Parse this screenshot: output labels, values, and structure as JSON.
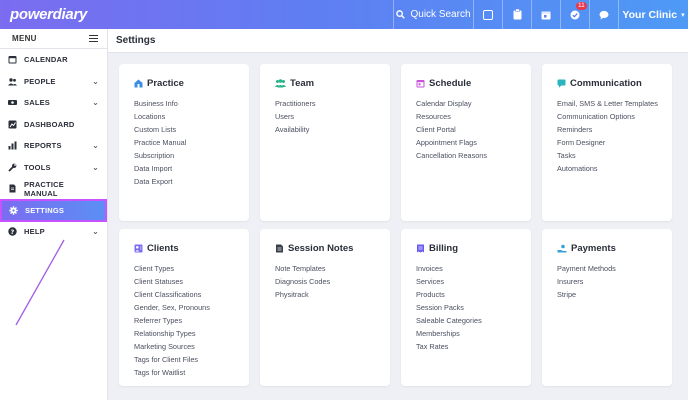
{
  "app": {
    "logo": "powerdiary"
  },
  "topbar": {
    "search_label": "Quick Search",
    "notification_count": "11",
    "clinic_label": "Your Clinic"
  },
  "sidebar": {
    "menu_label": "MENU",
    "items": [
      {
        "label": "CALENDAR",
        "icon": "calendar-icon",
        "chevron": ""
      },
      {
        "label": "PEOPLE",
        "icon": "people-icon",
        "chevron": "⌄"
      },
      {
        "label": "SALES",
        "icon": "sales-icon",
        "chevron": "⌄"
      },
      {
        "label": "DASHBOARD",
        "icon": "dashboard-icon",
        "chevron": ""
      },
      {
        "label": "REPORTS",
        "icon": "reports-icon",
        "chevron": "⌄"
      },
      {
        "label": "TOOLS",
        "icon": "wrench-icon",
        "chevron": "⌄"
      },
      {
        "label": "PRACTICE MANUAL",
        "icon": "document-icon",
        "chevron": ""
      },
      {
        "label": "SETTINGS",
        "icon": "gear-icon",
        "chevron": ""
      },
      {
        "label": "HELP",
        "icon": "help-icon",
        "chevron": "⌄"
      }
    ]
  },
  "page": {
    "title": "Settings"
  },
  "colors": {
    "practice": "#3a8ee6",
    "team": "#27b38a",
    "schedule": "#c653d8",
    "communication": "#2bb3c0",
    "clients": "#7b6cf0",
    "session_notes": "#3a3f4a",
    "billing": "#6a5cf0",
    "payments": "#36a0d8"
  },
  "cards": [
    {
      "title": "Practice",
      "links": [
        "Business Info",
        "Locations",
        "Custom Lists",
        "Practice Manual",
        "Subscription",
        "Data Import",
        "Data Export"
      ]
    },
    {
      "title": "Team",
      "links": [
        "Practitioners",
        "Users",
        "Availability"
      ]
    },
    {
      "title": "Schedule",
      "links": [
        "Calendar Display",
        "Resources",
        "Client Portal",
        "Appointment Flags",
        "Cancellation Reasons"
      ]
    },
    {
      "title": "Communication",
      "links": [
        "Email, SMS & Letter Templates",
        "Communication Options",
        "Reminders",
        "Form Designer",
        "Tasks",
        "Automations"
      ]
    },
    {
      "title": "Clients",
      "links": [
        "Client Types",
        "Client Statuses",
        "Client Classifications",
        "Gender, Sex, Pronouns",
        "Referrer Types",
        "Relationship Types",
        "Marketing Sources",
        "Tags for Client Files",
        "Tags for Waitlist"
      ]
    },
    {
      "title": "Session Notes",
      "links": [
        "Note Templates",
        "Diagnosis Codes",
        "Physitrack"
      ]
    },
    {
      "title": "Billing",
      "links": [
        "Invoices",
        "Services",
        "Products",
        "Session Packs",
        "Saleable Categories",
        "Memberships",
        "Tax Rates"
      ]
    },
    {
      "title": "Payments",
      "links": [
        "Payment Methods",
        "Insurers",
        "Stripe"
      ]
    }
  ]
}
